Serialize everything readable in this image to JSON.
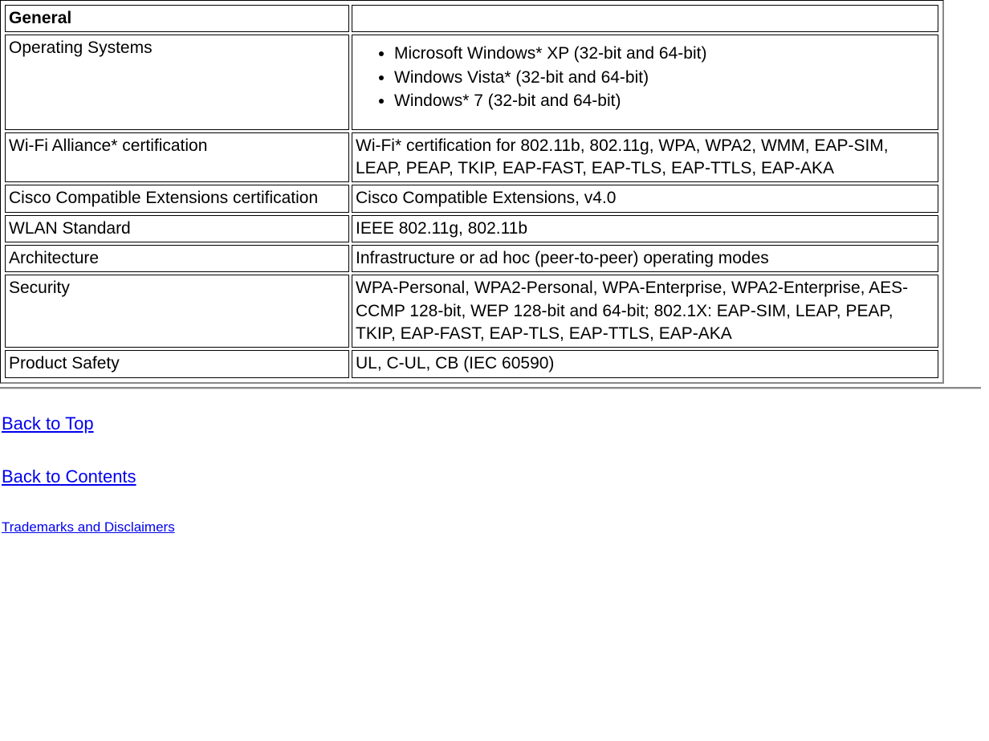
{
  "table": {
    "header": "General",
    "rows": [
      {
        "label": "Operating Systems",
        "type": "list",
        "items": [
          "Microsoft Windows* XP (32-bit and 64-bit)",
          "Windows Vista* (32-bit and 64-bit)",
          "Windows* 7 (32-bit and 64-bit)"
        ]
      },
      {
        "label": "Wi-Fi Alliance* certification",
        "value": "Wi-Fi* certification for 802.11b, 802.11g, WPA, WPA2, WMM, EAP-SIM, LEAP, PEAP, TKIP, EAP-FAST, EAP-TLS, EAP-TTLS, EAP-AKA"
      },
      {
        "label": "Cisco Compatible Extensions certification",
        "value": "Cisco Compatible Extensions, v4.0"
      },
      {
        "label": "WLAN Standard",
        "value": "IEEE 802.11g, 802.11b"
      },
      {
        "label": "Architecture",
        "value": "Infrastructure or ad hoc (peer-to-peer) operating modes"
      },
      {
        "label": "Security",
        "value": "WPA-Personal, WPA2-Personal, WPA-Enterprise, WPA2-Enterprise, AES-CCMP 128-bit, WEP 128-bit and 64-bit; 802.1X: EAP-SIM, LEAP, PEAP, TKIP, EAP-FAST, EAP-TLS, EAP-TTLS, EAP-AKA"
      },
      {
        "label": "Product Safety",
        "value": "UL, C-UL, CB (IEC 60590)"
      }
    ]
  },
  "links": {
    "back_to_top": "Back to Top",
    "back_to_contents": "Back to Contents",
    "trademarks": "Trademarks and Disclaimers"
  }
}
